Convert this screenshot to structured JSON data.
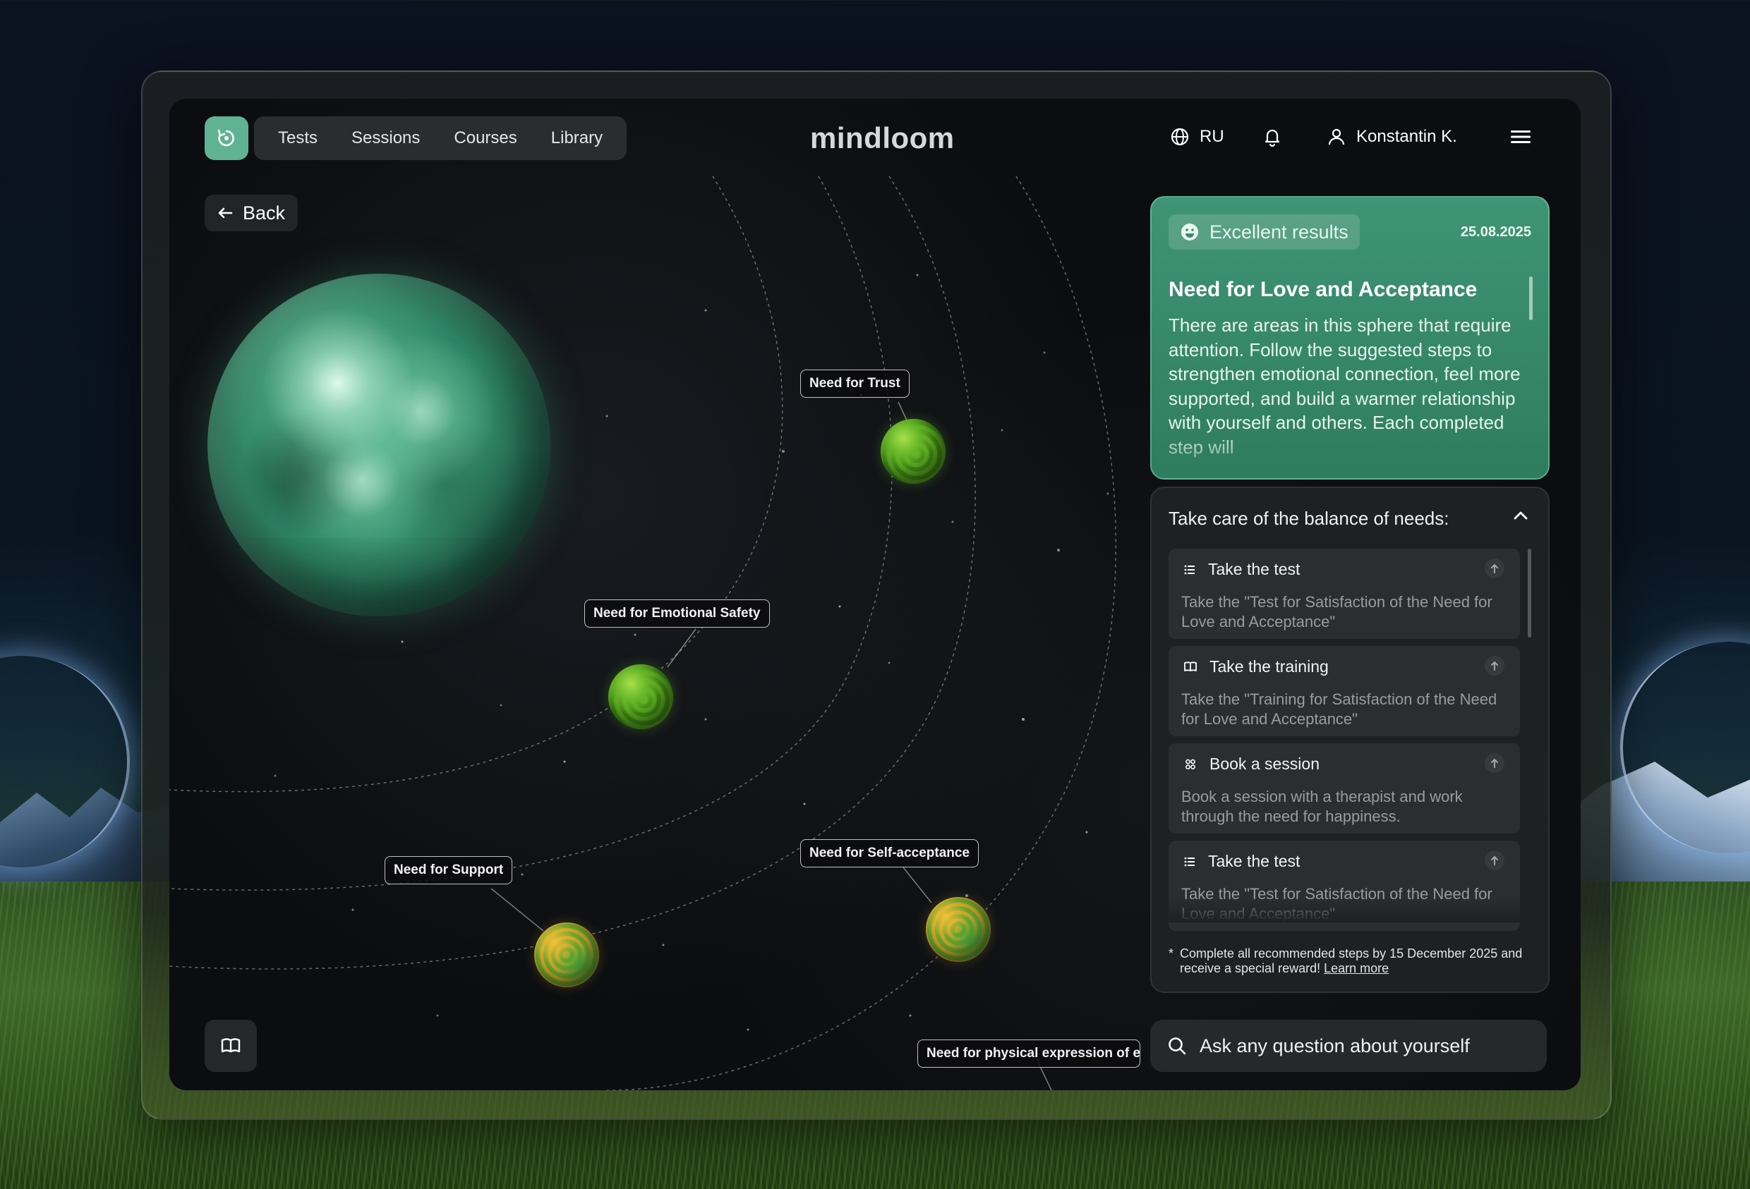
{
  "nav": {
    "items": [
      "Tests",
      "Sessions",
      "Courses",
      "Library"
    ],
    "brand": "mindloom",
    "language": "RU",
    "user_name": "Konstantin K."
  },
  "back_label": "Back",
  "map": {
    "labels": {
      "trust": "Need for Trust",
      "emotional_safety": "Need for Emotional Safety",
      "support": "Need for Support",
      "self_acceptance": "Need for  Self-acceptance",
      "physical_expression": "Need for physical expression of em"
    }
  },
  "result": {
    "badge": "Excellent results",
    "date": "25.08.2025",
    "title": "Need for Love and Acceptance",
    "body": "There are areas in this sphere that require attention. Follow the suggested steps to strengthen emotional connection, feel more supported, and build a warmer relationship with yourself and others. Each completed step will"
  },
  "needs": {
    "title": "Take care of the balance of needs:",
    "steps": [
      {
        "icon": "list-icon",
        "title": "Take the test",
        "desc": "Take the \"Test for Satisfaction of the Need for Love and Acceptance\""
      },
      {
        "icon": "book-icon",
        "title": "Take the training",
        "desc": "Take the \"Training for Satisfaction of the Need for Love and Acceptance\""
      },
      {
        "icon": "people-icon",
        "title": "Book a session",
        "desc": "Book a session with a therapist and work through the need for happiness."
      },
      {
        "icon": "list-icon",
        "title": "Take the test",
        "desc": "Take the \"Test for Satisfaction of the Need for Love and Acceptance\""
      }
    ],
    "note_star": "*",
    "note": "Complete all recommended steps by 15 December 2025 and receive a special reward!",
    "learn_more": "Learn more"
  },
  "ask_placeholder": "Ask any question about yourself",
  "colors": {
    "accent": "#5fb393",
    "card_green": "#2f7d60",
    "panel": "#1f2024"
  }
}
